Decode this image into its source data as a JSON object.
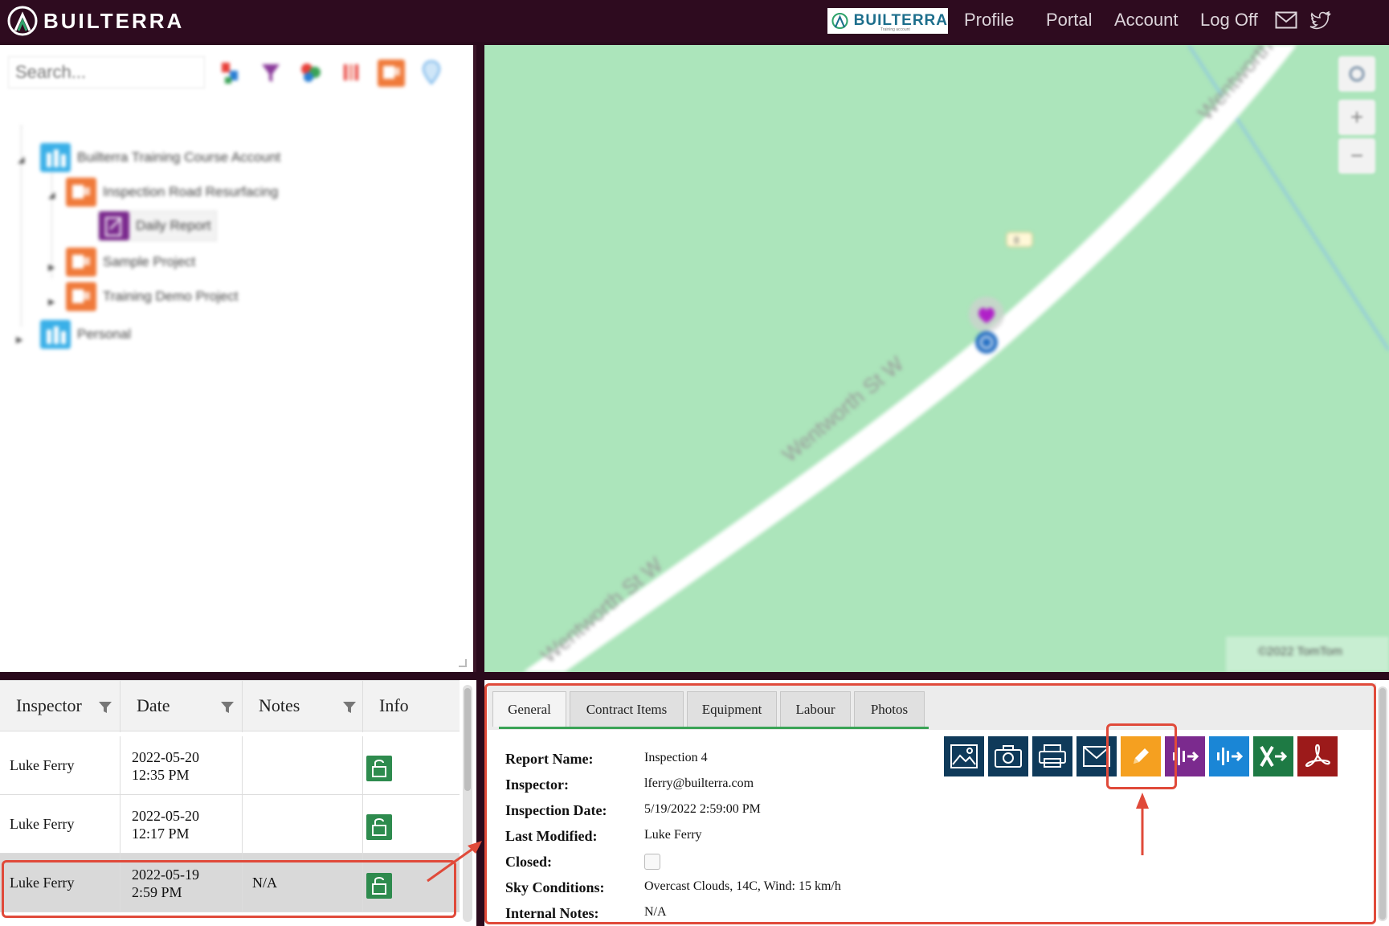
{
  "header": {
    "logo_text": "BUILTERRA",
    "badge_text": "BUILTERRA",
    "badge_sub": "Training account",
    "nav": [
      "Profile",
      "Portal",
      "Account",
      "Log Off"
    ]
  },
  "tree": {
    "search_placeholder": "Search...",
    "nodes": [
      {
        "label": "Builterra Training Course Account"
      },
      {
        "label": "Inspection Road Resurfacing"
      },
      {
        "label": "Daily Report"
      },
      {
        "label": "Sample Project"
      },
      {
        "label": "Training Demo Project"
      },
      {
        "label": "Personal"
      }
    ]
  },
  "map": {
    "road_labels": [
      "Wentworth St",
      "Wentworth St W",
      "Wentworth St W"
    ],
    "road_badge": "8",
    "attribution": "©2022 TomTom",
    "zoom_in": "+",
    "zoom_out": "−"
  },
  "grid": {
    "columns": [
      "Inspector",
      "Date",
      "Notes",
      "Info"
    ],
    "rows": [
      {
        "inspector": "Luke Ferry",
        "date1": "2022-05-20",
        "date2": "12:35 PM",
        "notes": ""
      },
      {
        "inspector": "Luke Ferry",
        "date1": "2022-05-20",
        "date2": "12:17 PM",
        "notes": ""
      },
      {
        "inspector": "Luke Ferry",
        "date1": "2022-05-19",
        "date2": "2:59 PM",
        "notes": "N/A"
      }
    ]
  },
  "detail": {
    "tabs": [
      "General",
      "Contract Items",
      "Equipment",
      "Labour",
      "Photos"
    ],
    "fields": [
      {
        "label": "Report Name:",
        "value": "Inspection 4"
      },
      {
        "label": "Inspector:",
        "value": "lferry@builterra.com"
      },
      {
        "label": "Inspection Date:",
        "value": "5/19/2022 2:59:00 PM"
      },
      {
        "label": "Last Modified:",
        "value": "Luke Ferry"
      },
      {
        "label": "Closed:",
        "value": ""
      },
      {
        "label": "Sky Conditions:",
        "value": "Overcast Clouds, 14C, Wind: 15 km/h"
      },
      {
        "label": "Internal Notes:",
        "value": "N/A"
      }
    ],
    "actions": [
      {
        "name": "image-icon",
        "color": "#0f3a5a"
      },
      {
        "name": "camera-icon",
        "color": "#0f3a5a"
      },
      {
        "name": "printer-icon",
        "color": "#0f3a5a"
      },
      {
        "name": "email-icon",
        "color": "#0f3a5a"
      },
      {
        "name": "pencil-icon",
        "color": "#f5a020"
      },
      {
        "name": "audio-export-icon",
        "color": "#7b2a8e"
      },
      {
        "name": "audio-import-icon",
        "color": "#1a86d6"
      },
      {
        "name": "excel-icon",
        "color": "#1e7a44"
      },
      {
        "name": "pdf-icon",
        "color": "#9c1a1a"
      }
    ]
  }
}
